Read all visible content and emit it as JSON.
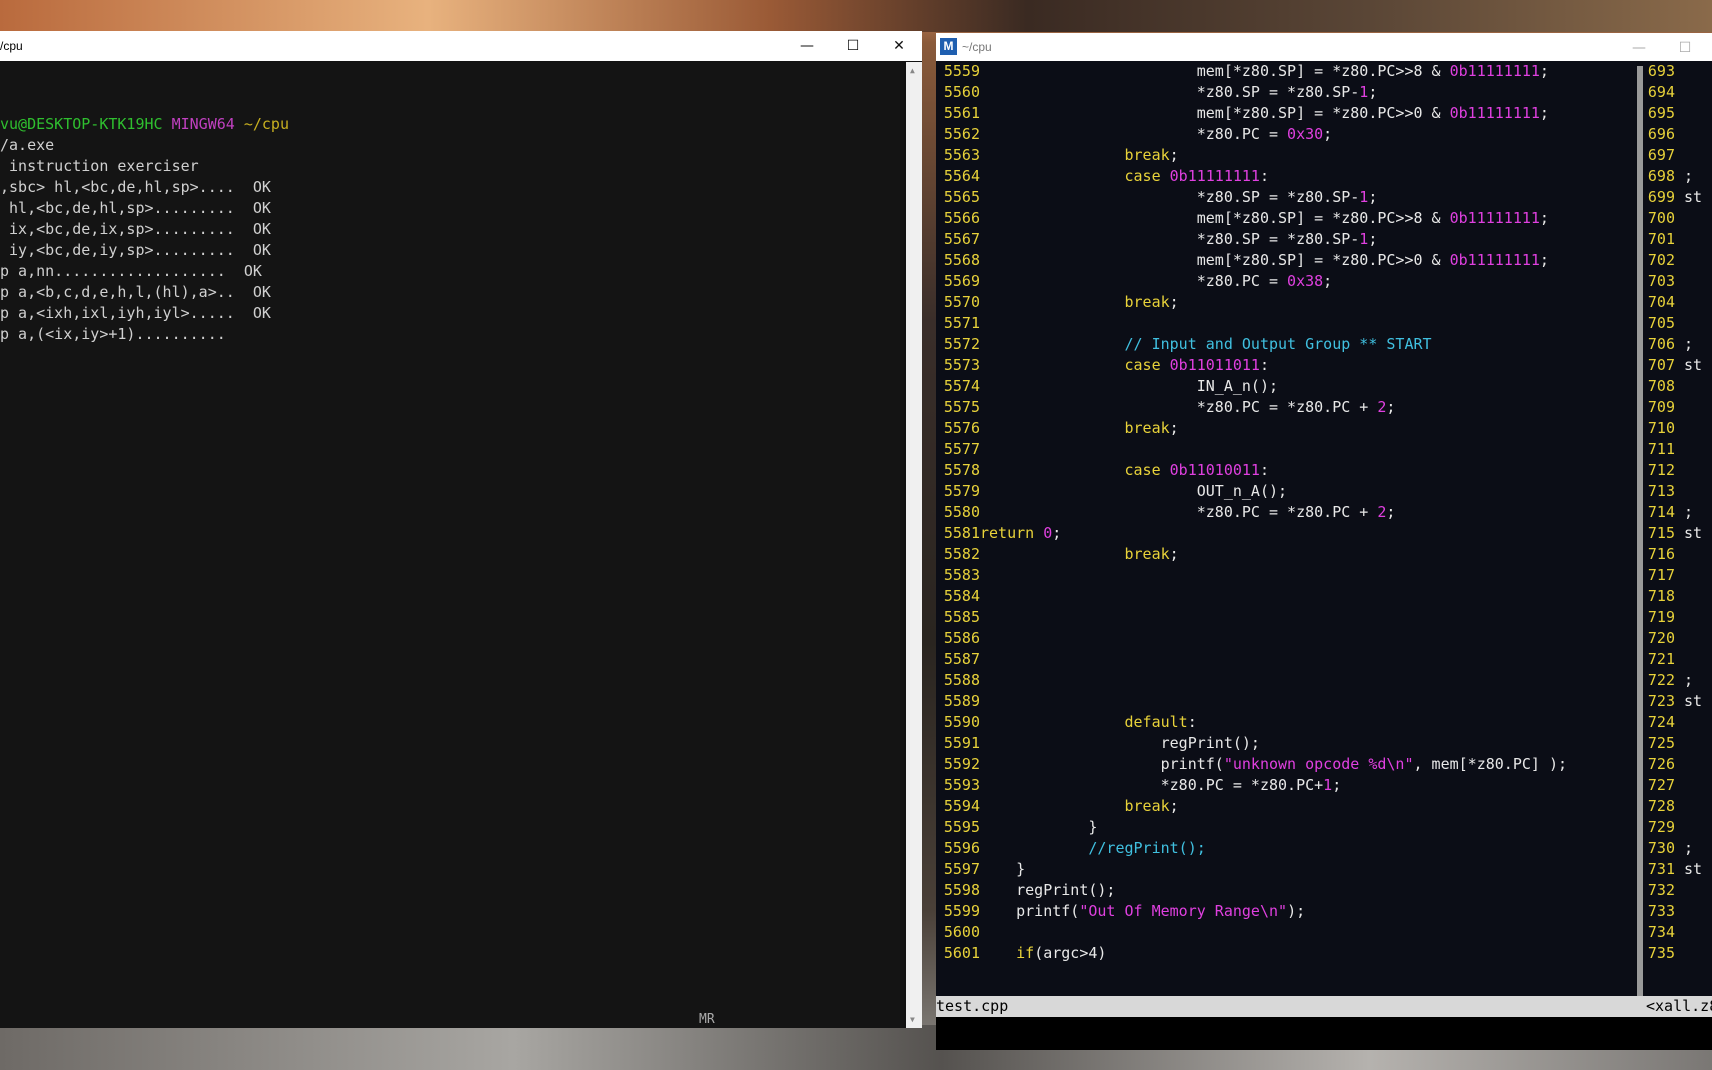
{
  "terminal": {
    "title": "/cpu",
    "controls": {
      "minimize": "—",
      "maximize": "☐",
      "close": "✕"
    },
    "prompt": {
      "user": "vu@DESKTOP-KTK19HC",
      "system": "MINGW64",
      "path": "~/cpu"
    },
    "lines": [
      "/a.exe",
      " instruction exerciser",
      ",sbc> hl,<bc,de,hl,sp>....  OK",
      " hl,<bc,de,hl,sp>.........  OK",
      " ix,<bc,de,ix,sp>.........  OK",
      " iy,<bc,de,iy,sp>.........  OK",
      "p a,nn...................  OK",
      "p a,<b,c,d,e,h,l,(hl),a>..  OK",
      "p a,<ixh,ixl,iyh,iyl>.....  OK",
      "p a,(<ix,iy>+1).........."
    ]
  },
  "editor": {
    "title": "~/cpu",
    "app_icon": "M",
    "statusbar_file": "test.cpp",
    "statusbar_right": "<xall.z8",
    "mini_label": "MR",
    "code": [
      {
        "n": "5559",
        "t": [
          [
            "pl",
            "                        mem[*z80.SP] = *z80.PC>>8 & "
          ],
          [
            "num",
            "0b11111111"
          ],
          [
            "pl",
            ";"
          ]
        ]
      },
      {
        "n": "5560",
        "t": [
          [
            "pl",
            "                        *z80.SP = *z80.SP-"
          ],
          [
            "num",
            "1"
          ],
          [
            "pl",
            ";"
          ]
        ]
      },
      {
        "n": "5561",
        "t": [
          [
            "pl",
            "                        mem[*z80.SP] = *z80.PC>>0 & "
          ],
          [
            "num",
            "0b11111111"
          ],
          [
            "pl",
            ";"
          ]
        ]
      },
      {
        "n": "5562",
        "t": [
          [
            "pl",
            "                        *z80.PC = "
          ],
          [
            "num",
            "0x30"
          ],
          [
            "pl",
            ";"
          ]
        ]
      },
      {
        "n": "5563",
        "t": [
          [
            "kw",
            "                break"
          ],
          [
            "pl",
            ";"
          ]
        ]
      },
      {
        "n": "5564",
        "t": [
          [
            "kw",
            "                case "
          ],
          [
            "num",
            "0b11111111"
          ],
          [
            "pl",
            ":"
          ]
        ]
      },
      {
        "n": "5565",
        "t": [
          [
            "pl",
            "                        *z80.SP = *z80.SP-"
          ],
          [
            "num",
            "1"
          ],
          [
            "pl",
            ";"
          ]
        ]
      },
      {
        "n": "5566",
        "t": [
          [
            "pl",
            "                        mem[*z80.SP] = *z80.PC>>8 & "
          ],
          [
            "num",
            "0b11111111"
          ],
          [
            "pl",
            ";"
          ]
        ]
      },
      {
        "n": "5567",
        "t": [
          [
            "pl",
            "                        *z80.SP = *z80.SP-"
          ],
          [
            "num",
            "1"
          ],
          [
            "pl",
            ";"
          ]
        ]
      },
      {
        "n": "5568",
        "t": [
          [
            "pl",
            "                        mem[*z80.SP] = *z80.PC>>0 & "
          ],
          [
            "num",
            "0b11111111"
          ],
          [
            "pl",
            ";"
          ]
        ]
      },
      {
        "n": "5569",
        "t": [
          [
            "pl",
            "                        *z80.PC = "
          ],
          [
            "num",
            "0x38"
          ],
          [
            "pl",
            ";"
          ]
        ]
      },
      {
        "n": "5570",
        "t": [
          [
            "kw",
            "                break"
          ],
          [
            "pl",
            ";"
          ]
        ]
      },
      {
        "n": "5571",
        "t": []
      },
      {
        "n": "5572",
        "t": [
          [
            "cm",
            "                // Input and Output Group ** START"
          ]
        ]
      },
      {
        "n": "5573",
        "t": [
          [
            "kw",
            "                case "
          ],
          [
            "num",
            "0b11011011"
          ],
          [
            "pl",
            ":"
          ]
        ]
      },
      {
        "n": "5574",
        "t": [
          [
            "pl",
            "                        IN_A_n();"
          ]
        ]
      },
      {
        "n": "5575",
        "t": [
          [
            "pl",
            "                        *z80.PC = *z80.PC + "
          ],
          [
            "num",
            "2"
          ],
          [
            "pl",
            ";"
          ]
        ]
      },
      {
        "n": "5576",
        "t": [
          [
            "kw",
            "                break"
          ],
          [
            "pl",
            ";"
          ]
        ]
      },
      {
        "n": "5577",
        "t": []
      },
      {
        "n": "5578",
        "t": [
          [
            "kw",
            "                case "
          ],
          [
            "num",
            "0b11010011"
          ],
          [
            "pl",
            ":"
          ]
        ]
      },
      {
        "n": "5579",
        "t": [
          [
            "pl",
            "                        OUT_n_A();"
          ]
        ]
      },
      {
        "n": "5580",
        "t": [
          [
            "pl",
            "                        *z80.PC = *z80.PC + "
          ],
          [
            "num",
            "2"
          ],
          [
            "pl",
            ";"
          ]
        ]
      },
      {
        "n": "5581",
        "t": [
          [
            "kw",
            "return "
          ],
          [
            "num",
            "0"
          ],
          [
            "pl",
            ";"
          ]
        ]
      },
      {
        "n": "5582",
        "t": [
          [
            "kw",
            "                break"
          ],
          [
            "pl",
            ";"
          ]
        ]
      },
      {
        "n": "5583",
        "t": []
      },
      {
        "n": "5584",
        "t": []
      },
      {
        "n": "5585",
        "t": []
      },
      {
        "n": "5586",
        "t": []
      },
      {
        "n": "5587",
        "t": []
      },
      {
        "n": "5588",
        "t": []
      },
      {
        "n": "5589",
        "t": []
      },
      {
        "n": "5590",
        "t": [
          [
            "kw",
            "                default"
          ],
          [
            "pl",
            ":"
          ]
        ]
      },
      {
        "n": "5591",
        "t": [
          [
            "pl",
            "                    regPrint();"
          ]
        ]
      },
      {
        "n": "5592",
        "t": [
          [
            "pl",
            "                    printf("
          ],
          [
            "str",
            "\"unknown opcode %d\\n\""
          ],
          [
            "pl",
            ", mem[*z80.PC] );"
          ]
        ]
      },
      {
        "n": "5593",
        "t": [
          [
            "pl",
            "                    *z80.PC = *z80.PC+"
          ],
          [
            "num",
            "1"
          ],
          [
            "pl",
            ";"
          ]
        ]
      },
      {
        "n": "5594",
        "t": [
          [
            "kw",
            "                break"
          ],
          [
            "pl",
            ";"
          ]
        ]
      },
      {
        "n": "5595",
        "t": [
          [
            "pl",
            "            }"
          ]
        ]
      },
      {
        "n": "5596",
        "t": [
          [
            "cm",
            "            //regPrint();"
          ]
        ]
      },
      {
        "n": "5597",
        "t": [
          [
            "pl",
            "    }"
          ]
        ]
      },
      {
        "n": "5598",
        "t": [
          [
            "pl",
            "    regPrint();"
          ]
        ]
      },
      {
        "n": "5599",
        "t": [
          [
            "pl",
            "    printf("
          ],
          [
            "str",
            "\"Out Of Memory Range\\n\""
          ],
          [
            "pl",
            ");"
          ]
        ]
      },
      {
        "n": "5600",
        "t": []
      },
      {
        "n": "5601",
        "t": [
          [
            "kw",
            "    if"
          ],
          [
            "pl",
            "(argc>4)"
          ]
        ]
      }
    ],
    "right_pane": [
      {
        "n": "693",
        "t": ""
      },
      {
        "n": "694",
        "t": ""
      },
      {
        "n": "695",
        "t": ""
      },
      {
        "n": "696",
        "t": ""
      },
      {
        "n": "697",
        "t": ""
      },
      {
        "n": "698",
        "t": " ;"
      },
      {
        "n": "699",
        "t": " st"
      },
      {
        "n": "700",
        "t": ""
      },
      {
        "n": "701",
        "t": ""
      },
      {
        "n": "702",
        "t": ""
      },
      {
        "n": "703",
        "t": ""
      },
      {
        "n": "704",
        "t": ""
      },
      {
        "n": "705",
        "t": ""
      },
      {
        "n": "706",
        "t": " ;"
      },
      {
        "n": "707",
        "t": " st"
      },
      {
        "n": "708",
        "t": ""
      },
      {
        "n": "709",
        "t": ""
      },
      {
        "n": "710",
        "t": ""
      },
      {
        "n": "711",
        "t": ""
      },
      {
        "n": "712",
        "t": ""
      },
      {
        "n": "713",
        "t": ""
      },
      {
        "n": "714",
        "t": " ;"
      },
      {
        "n": "715",
        "t": " st"
      },
      {
        "n": "716",
        "t": ""
      },
      {
        "n": "717",
        "t": ""
      },
      {
        "n": "718",
        "t": ""
      },
      {
        "n": "719",
        "t": ""
      },
      {
        "n": "720",
        "t": ""
      },
      {
        "n": "721",
        "t": ""
      },
      {
        "n": "722",
        "t": " ;"
      },
      {
        "n": "723",
        "t": " st"
      },
      {
        "n": "724",
        "t": ""
      },
      {
        "n": "725",
        "t": ""
      },
      {
        "n": "726",
        "t": ""
      },
      {
        "n": "727",
        "t": ""
      },
      {
        "n": "728",
        "t": ""
      },
      {
        "n": "729",
        "t": ""
      },
      {
        "n": "730",
        "t": " ;"
      },
      {
        "n": "731",
        "t": " st"
      },
      {
        "n": "732",
        "t": ""
      },
      {
        "n": "733",
        "t": ""
      },
      {
        "n": "734",
        "t": ""
      },
      {
        "n": "735",
        "t": ""
      }
    ]
  }
}
